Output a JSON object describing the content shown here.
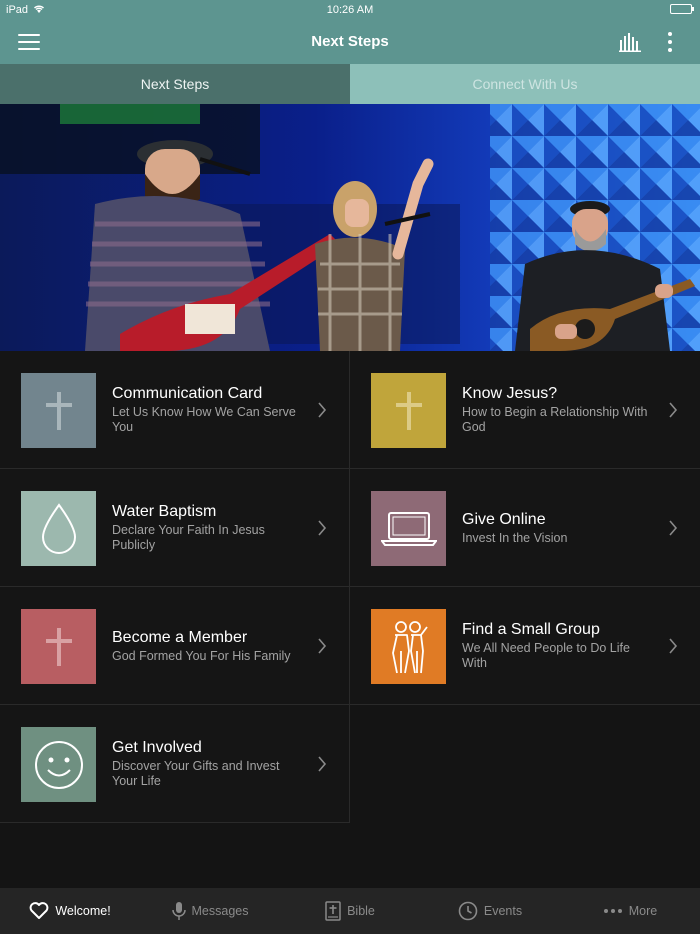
{
  "status_bar": {
    "device": "iPad",
    "time": "10:26 AM"
  },
  "nav": {
    "title": "Next Steps"
  },
  "tabs": [
    {
      "label": "Next Steps",
      "active": true
    },
    {
      "label": "Connect With Us",
      "active": false
    }
  ],
  "cards": [
    {
      "title": "Communication Card",
      "subtitle": "Let Us Know How We Can Serve You",
      "icon": "cross-icon",
      "color": "#72858e"
    },
    {
      "title": "Know Jesus?",
      "subtitle": "How to Begin a Relationship With God",
      "icon": "cross-icon",
      "color": "#c0a53b"
    },
    {
      "title": "Water Baptism",
      "subtitle": "Declare Your Faith In Jesus Publicly",
      "icon": "water-drop-icon",
      "color": "#9cb8ae"
    },
    {
      "title": "Give Online",
      "subtitle": "Invest In the Vision",
      "icon": "laptop-icon",
      "color": "#8e6a76"
    },
    {
      "title": "Become a Member",
      "subtitle": "God Formed You For His Family",
      "icon": "cross-icon",
      "color": "#b85e62"
    },
    {
      "title": "Find a Small Group",
      "subtitle": "We All Need People to Do Life With",
      "icon": "group-icon",
      "color": "#e07b25"
    },
    {
      "title": "Get Involved",
      "subtitle": "Discover Your Gifts and Invest Your Life",
      "icon": "smiley-icon",
      "color": "#6f9081"
    }
  ],
  "tabbar": [
    {
      "label": "Welcome!",
      "icon": "heart-icon",
      "active": true
    },
    {
      "label": "Messages",
      "icon": "microphone-icon",
      "active": false
    },
    {
      "label": "Bible",
      "icon": "bible-icon",
      "active": false
    },
    {
      "label": "Events",
      "icon": "clock-icon",
      "active": false
    },
    {
      "label": "More",
      "icon": "more-dots-icon",
      "active": false
    }
  ],
  "colors": {
    "nav": "#5d9590",
    "tab_active": "#4b706b",
    "tab_inactive": "#8dc0b9",
    "background": "#141414"
  }
}
